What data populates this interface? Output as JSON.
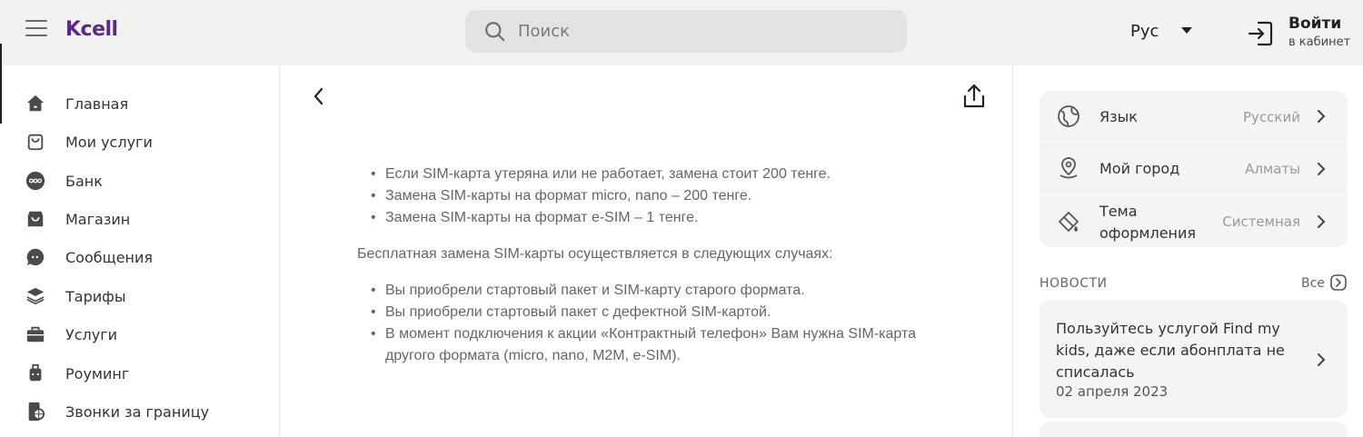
{
  "header": {
    "logo": "Kcell",
    "search_placeholder": "Поиск",
    "language": "Рус",
    "login_title": "Войти",
    "login_subtitle": "в кабинет"
  },
  "sidebar": {
    "items": [
      {
        "label": "Главная",
        "icon": "home-icon"
      },
      {
        "label": "Мои услуги",
        "icon": "bag-icon"
      },
      {
        "label": "Банк",
        "icon": "bank-icon"
      },
      {
        "label": "Магазин",
        "icon": "shop-icon"
      },
      {
        "label": "Сообщения",
        "icon": "chat-icon"
      },
      {
        "label": "Тарифы",
        "icon": "layers-icon"
      },
      {
        "label": "Услуги",
        "icon": "briefcase-icon"
      },
      {
        "label": "Роуминг",
        "icon": "luggage-icon"
      },
      {
        "label": "Звонки за границу",
        "icon": "phone-globe-icon"
      }
    ]
  },
  "article": {
    "list1": [
      "Если SIM-карта утеряна или не работает, замена стоит 200 тенге.",
      "Замена SIM-карты на формат micro, nano – 200 тенге.",
      "Замена SIM-карты на формат e-SIM – 1 тенге."
    ],
    "paragraph": "Бесплатная замена SIM-карты осуществляется в следующих случаях:",
    "list2": [
      "Вы приобрели стартовый пакет и SIM-карту старого формата.",
      "Вы приобрели стартовый пакет с дефектной SIM-картой.",
      "В момент подключения к акции «Контрактный телефон» Вам нужна SIM-карта другого формата (micro, nano, M2M, e-SIM)."
    ]
  },
  "settings": {
    "language_label": "Язык",
    "language_value": "Русский",
    "city_label": "Мой город",
    "city_value": "Алматы",
    "theme_label_line1": "Тема",
    "theme_label_line2": "оформления",
    "theme_value": "Системная"
  },
  "news": {
    "heading": "НОВОСТИ",
    "all_label": "Все",
    "items": [
      {
        "title": "Пользуйтесь услугой Find my kids, даже если абонплата не списалась",
        "date": "02 апреля 2023"
      }
    ]
  },
  "colors": {
    "brand": "#5b2a86",
    "header_bg": "#f2f2f2",
    "panel_bg": "#f4f4f4"
  }
}
